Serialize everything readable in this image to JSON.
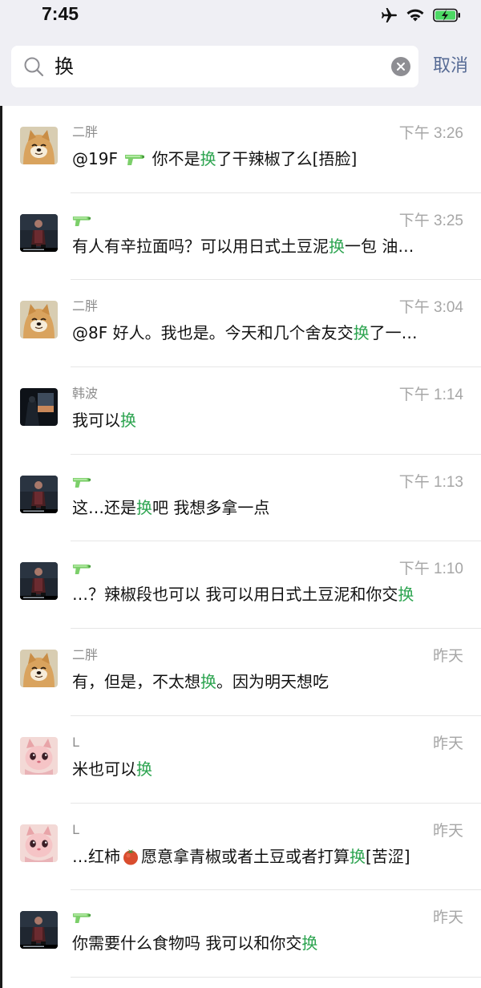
{
  "status_bar": {
    "time": "7:45",
    "icons": [
      "airplane-icon",
      "wifi-icon",
      "battery-charging-icon"
    ]
  },
  "search": {
    "query": "换",
    "cancel_label": "取消"
  },
  "highlight_color": "#2da450",
  "results": [
    {
      "name": "二胖",
      "avatar": "shiba-avatar",
      "time": "下午 3:26",
      "pre": "@19F ",
      "gun_inline": true,
      "mid": " 你不是",
      "hl": "换",
      "post": "了干辣椒了么[捂脸]"
    },
    {
      "name": "",
      "avatar": "dark-figure-avatar",
      "name_icon": "water-gun-icon",
      "time": "下午 3:25",
      "pre": "有人有辛拉面吗？可以用日式土豆泥",
      "hl": "换",
      "post": "一包 油…"
    },
    {
      "name": "二胖",
      "avatar": "shiba-avatar",
      "time": "下午 3:04",
      "pre": "@8F 好人。我也是。今天和几个舍友交",
      "hl": "换",
      "post": "了一…"
    },
    {
      "name": "韩波",
      "avatar": "night-photo-avatar",
      "time": "下午 1:14",
      "pre": "我可以",
      "hl": "换",
      "post": ""
    },
    {
      "name": "",
      "avatar": "dark-figure-avatar",
      "name_icon": "water-gun-icon",
      "time": "下午 1:13",
      "pre": "这…还是",
      "hl": "换",
      "post": "吧 我想多拿一点"
    },
    {
      "name": "",
      "avatar": "dark-figure-avatar",
      "name_icon": "water-gun-icon",
      "time": "下午 1:10",
      "pre": "…？辣椒段也可以 我可以用日式土豆泥和你交",
      "hl": "换",
      "post": ""
    },
    {
      "name": "二胖",
      "avatar": "shiba-avatar",
      "time": "昨天",
      "pre": "有，但是，不太想",
      "hl": "换",
      "post": "。因为明天想吃"
    },
    {
      "name": "L",
      "avatar": "pink-creature-avatar",
      "time": "昨天",
      "pre": "米也可以",
      "hl": "换",
      "post": ""
    },
    {
      "name": "L",
      "avatar": "pink-creature-avatar",
      "time": "昨天",
      "pre": "…红柿",
      "tomato_inline": true,
      "mid": "愿意拿青椒或者土豆或者打算",
      "hl": "换",
      "post": "[苦涩]"
    },
    {
      "name": "",
      "avatar": "dark-figure-avatar",
      "name_icon": "water-gun-icon",
      "time": "昨天",
      "pre": "你需要什么食物吗 我可以和你交",
      "hl": "换",
      "post": ""
    }
  ]
}
